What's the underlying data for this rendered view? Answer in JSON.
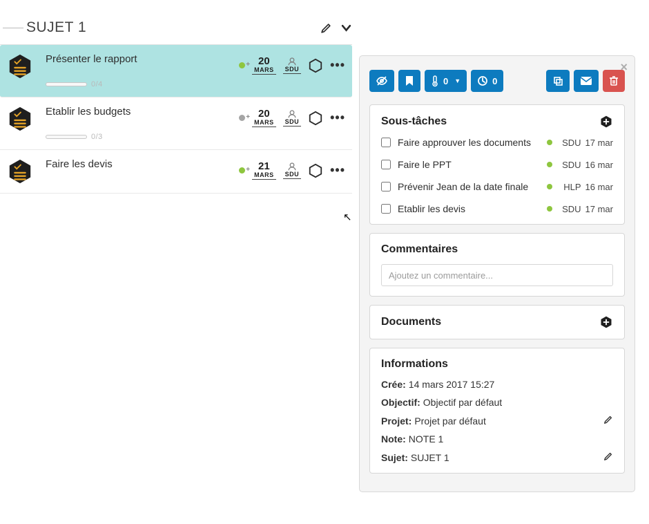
{
  "subject": {
    "title": "SUJET 1"
  },
  "tasks": [
    {
      "title": "Présenter le rapport",
      "progress": "0/4",
      "dot": "green",
      "day": "20",
      "month": "MARS",
      "who": "SDU",
      "selected": true
    },
    {
      "title": "Etablir les budgets",
      "progress": "0/3",
      "dot": "grey",
      "day": "20",
      "month": "MARS",
      "who": "SDU",
      "selected": false
    },
    {
      "title": "Faire les devis",
      "progress": "",
      "dot": "green",
      "day": "21",
      "month": "MARS",
      "who": "SDU",
      "selected": false
    }
  ],
  "panel": {
    "toolbar": {
      "temp_value": "0",
      "clock_value": "0"
    },
    "subtasks": {
      "title": "Sous-tâches",
      "items": [
        {
          "label": "Faire approuver les documents",
          "who": "SDU",
          "when": "17 mar"
        },
        {
          "label": "Faire le PPT",
          "who": "SDU",
          "when": "16 mar"
        },
        {
          "label": "Prévenir Jean de la date finale",
          "who": "HLP",
          "when": "16 mar"
        },
        {
          "label": "Etablir les devis",
          "who": "SDU",
          "when": "17 mar"
        }
      ]
    },
    "comments": {
      "title": "Commentaires",
      "placeholder": "Ajoutez un commentaire..."
    },
    "documents": {
      "title": "Documents"
    },
    "info": {
      "title": "Informations",
      "created_label": "Crée:",
      "created_value": "14 mars 2017 15:27",
      "objective_label": "Objectif:",
      "objective_value": "Objectif par défaut",
      "project_label": "Projet:",
      "project_value": "Projet par défaut",
      "note_label": "Note:",
      "note_value": "NOTE 1",
      "subject_label": "Sujet:",
      "subject_value": "SUJET 1"
    }
  }
}
